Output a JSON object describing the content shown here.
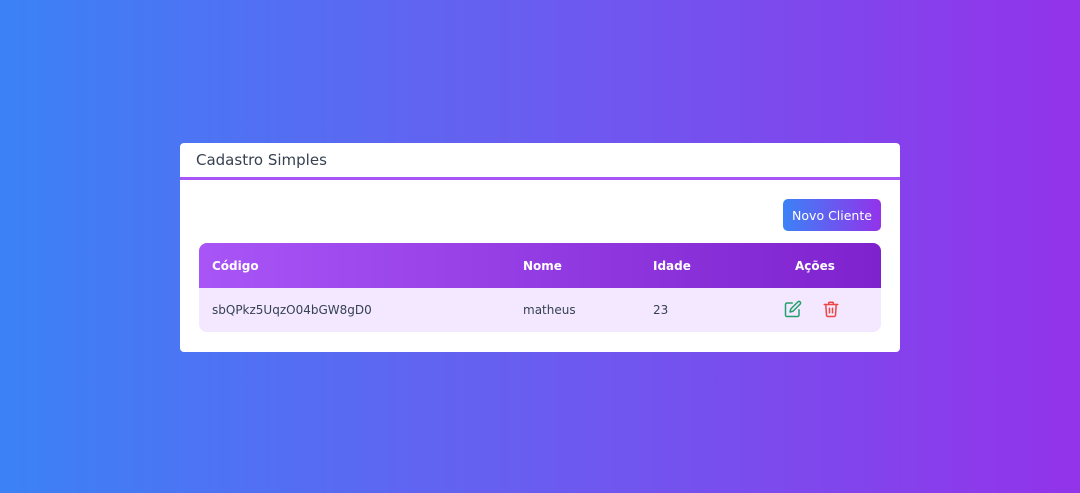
{
  "card": {
    "title": "Cadastro Simples"
  },
  "toolbar": {
    "new_label": "Novo Cliente"
  },
  "table": {
    "headers": [
      "Código",
      "Nome",
      "Idade",
      "Ações"
    ],
    "rows": [
      {
        "codigo": "sbQPkz5UqzO04bGW8gD0",
        "nome": "matheus",
        "idade": "23"
      }
    ]
  },
  "colors": {
    "accent": "#a855f7",
    "edit": "#22a06b",
    "delete": "#ef4444"
  },
  "icons": {
    "edit": "edit-icon",
    "delete": "trash-icon"
  }
}
